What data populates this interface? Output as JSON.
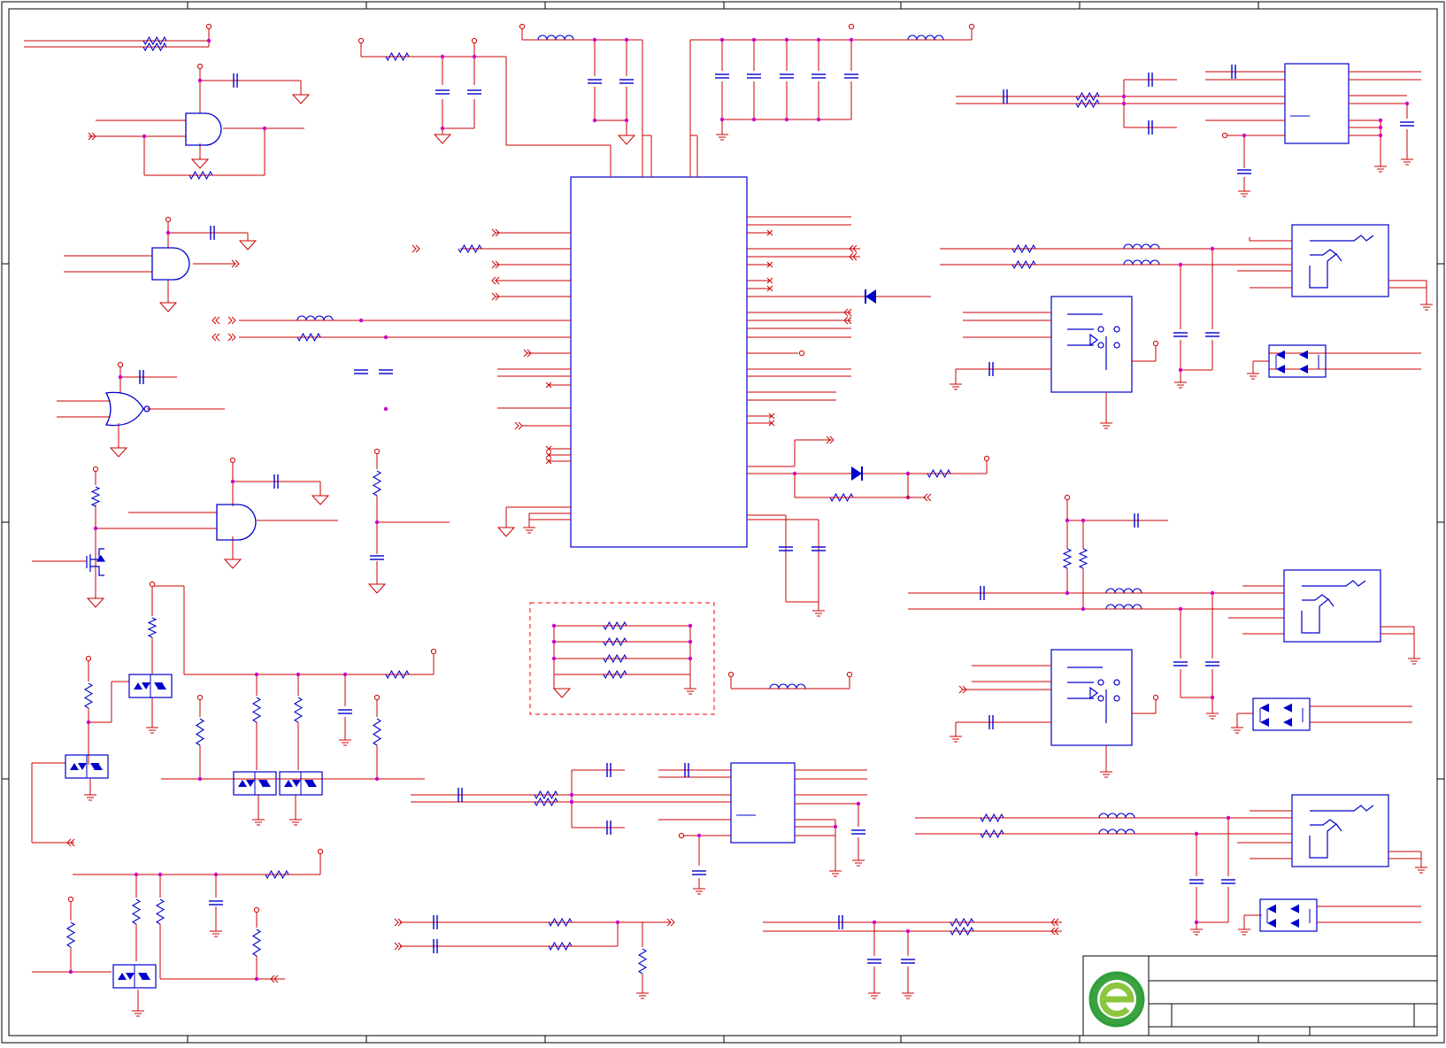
{
  "sheet": {
    "border_color": "#000000",
    "wire_color": "#cc0000",
    "component_color": "#0000cc",
    "junction_color": "#cc00cc",
    "frame_dash_color": "#ff0000"
  },
  "title_block": {
    "logo_icon": "green-e-logo-icon",
    "logo_colors": [
      "#2e9e3a",
      "#8cc63f"
    ]
  },
  "components": {
    "main_ic": "large-ic-block",
    "relays": [
      "relay-top",
      "relay-bottom"
    ],
    "jacks": [
      "jack-upper",
      "jack-middle",
      "jack-lower"
    ],
    "transceivers": [
      "transceiver-top-right",
      "transceiver-bottom-center"
    ],
    "gates": [
      "and-gate-1",
      "and-gate-2",
      "or-gate",
      "and-gate-3"
    ],
    "diode_arrays": 9
  }
}
